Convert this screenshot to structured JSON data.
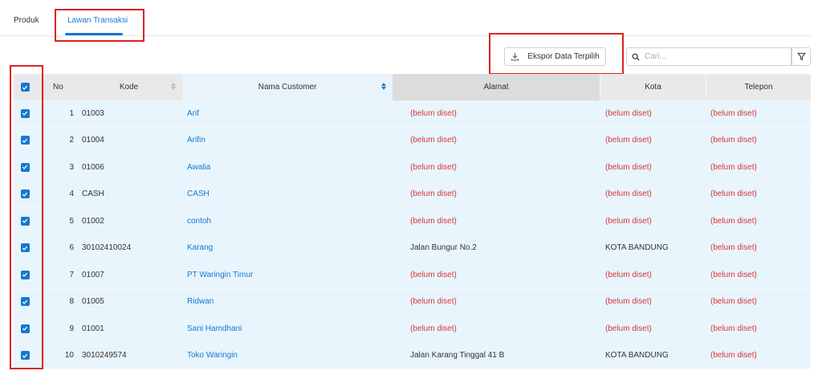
{
  "tabs": [
    {
      "label": "Produk",
      "active": false
    },
    {
      "label": "Lawan Transaksi",
      "active": true
    }
  ],
  "toolbar": {
    "export_label": "Ekspor Data Terpilih",
    "search_placeholder": "Cari...",
    "search_value": ""
  },
  "table": {
    "columns": {
      "no": "No",
      "kode": "Kode",
      "nama": "Nama Customer",
      "alamat": "Alamat",
      "kota": "Kota",
      "telepon": "Telepon"
    },
    "rows": [
      {
        "no": "1",
        "kode": "01003",
        "nama": "Arif",
        "alamat": "(belum diset)",
        "kota": "(belum diset)",
        "telepon": "(belum diset)"
      },
      {
        "no": "2",
        "kode": "01004",
        "nama": "Arifin",
        "alamat": "(belum diset)",
        "kota": "(belum diset)",
        "telepon": "(belum diset)"
      },
      {
        "no": "3",
        "kode": "01006",
        "nama": "Awalia",
        "alamat": "(belum diset)",
        "kota": "(belum diset)",
        "telepon": "(belum diset)"
      },
      {
        "no": "4",
        "kode": "CASH",
        "nama": "CASH",
        "alamat": "(belum diset)",
        "kota": "(belum diset)",
        "telepon": "(belum diset)"
      },
      {
        "no": "5",
        "kode": "01002",
        "nama": "contoh",
        "alamat": "(belum diset)",
        "kota": "(belum diset)",
        "telepon": "(belum diset)"
      },
      {
        "no": "6",
        "kode": "30102410024",
        "nama": "Karang",
        "alamat": "Jalan Bungur No.2",
        "kota": "KOTA BANDUNG",
        "telepon": "(belum diset)"
      },
      {
        "no": "7",
        "kode": "01007",
        "nama": "PT Waringin Timur",
        "alamat": "(belum diset)",
        "kota": "(belum diset)",
        "telepon": "(belum diset)"
      },
      {
        "no": "8",
        "kode": "01005",
        "nama": "Ridwan",
        "alamat": "(belum diset)",
        "kota": "(belum diset)",
        "telepon": "(belum diset)"
      },
      {
        "no": "9",
        "kode": "01001",
        "nama": "Sani Hamdhani",
        "alamat": "(belum diset)",
        "kota": "(belum diset)",
        "telepon": "(belum diset)"
      },
      {
        "no": "10",
        "kode": "3010249574",
        "nama": "Toko Waringin",
        "alamat": "Jalan Karang Tinggal 41 B",
        "kota": "KOTA BANDUNG",
        "telepon": "(belum diset)"
      }
    ],
    "unset_text": "(belum diset)"
  },
  "colors": {
    "accent": "#1677d2",
    "unset": "#d9363e",
    "row_selected": "#e8f5fc",
    "highlight_box": "#e02020"
  },
  "icons": {
    "export": "download-icon",
    "search": "search-icon",
    "filter": "filter-icon",
    "checkbox": "check-icon"
  }
}
